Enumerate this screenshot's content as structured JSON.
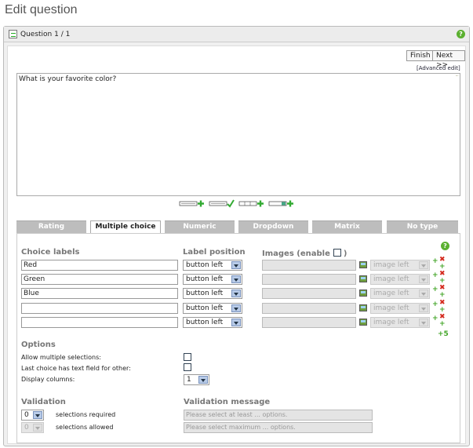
{
  "page": {
    "title": "Edit question"
  },
  "panel": {
    "title": "Question 1 / 1",
    "help_icon": "help-icon"
  },
  "toolbar": {
    "finish_label": "Finish",
    "next_label": "Next >>",
    "advanced_edit_label": "[Advanced edit]"
  },
  "editor": {
    "question_text": "What is your favorite color?"
  },
  "formatting_icons": [
    "add-row-icon",
    "edit-row-icon",
    "add-columns-icon",
    "add-image-row-icon"
  ],
  "tabs": [
    {
      "label": "Rating",
      "active": false
    },
    {
      "label": "Multiple choice",
      "active": true
    },
    {
      "label": "Numeric",
      "active": false
    },
    {
      "label": "Dropdown",
      "active": false
    },
    {
      "label": "Matrix",
      "active": false
    },
    {
      "label": "No type",
      "active": false
    }
  ],
  "choices": {
    "labels_header": "Choice labels",
    "position_header": "Label position",
    "images_header": "Images (enable",
    "images_header_close": ")",
    "rows": [
      {
        "label": "Red",
        "position": "button left",
        "image_position": "image left"
      },
      {
        "label": "Green",
        "position": "button left",
        "image_position": "image left"
      },
      {
        "label": "Blue",
        "position": "button left",
        "image_position": "image left"
      },
      {
        "label": "",
        "position": "button left",
        "image_position": "image left"
      },
      {
        "label": "",
        "position": "button left",
        "image_position": "image left"
      }
    ],
    "add_count_label": "5"
  },
  "options": {
    "header": "Options",
    "allow_multiple_label": "Allow multiple selections:",
    "last_choice_text_label": "Last choice has text field for other:",
    "display_columns_label": "Display columns:",
    "display_columns_value": "1"
  },
  "validation": {
    "header": "Validation",
    "required_value": "0",
    "required_label": "selections required",
    "allowed_value": "0",
    "allowed_label": "selections allowed",
    "message_header": "Validation message",
    "min_placeholder": "Please select at least ... options.",
    "max_placeholder": "Please select maximum ... options."
  },
  "colors": {
    "tab_active_bg": "#ffffff",
    "tab_inactive_bg": "#bdbdbd",
    "add_green": "#44a62a",
    "delete_red": "#d42a1e"
  }
}
